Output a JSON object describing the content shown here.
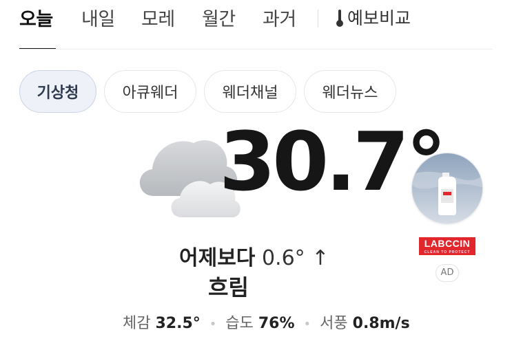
{
  "tabs": [
    {
      "label": "오늘",
      "active": true
    },
    {
      "label": "내일"
    },
    {
      "label": "모레"
    },
    {
      "label": "월간"
    },
    {
      "label": "과거"
    }
  ],
  "compare_tab": {
    "label": "예보비교",
    "icon": "thermometer-icon"
  },
  "providers": [
    {
      "label": "기상청",
      "active": true
    },
    {
      "label": "아큐웨더"
    },
    {
      "label": "웨더채널"
    },
    {
      "label": "웨더뉴스"
    }
  ],
  "current": {
    "icon": "cloudy-icon",
    "temperature": "30.7°",
    "compare_label": "어제보다",
    "compare_value": "0.6° ↑",
    "condition": "흐림"
  },
  "details": {
    "feels_like_label": "체감",
    "feels_like_value": "32.5°",
    "humidity_label": "습도",
    "humidity_value": "76%",
    "wind_label": "서풍",
    "wind_value": "0.8m/s"
  },
  "ad": {
    "brand": "LABCCIN",
    "tagline": "CLEAN TO PROTECT",
    "badge": "AD"
  },
  "colors": {
    "brand_red": "#e1262c",
    "active_chip_bg": "#eef1f7",
    "text": "#111111"
  }
}
